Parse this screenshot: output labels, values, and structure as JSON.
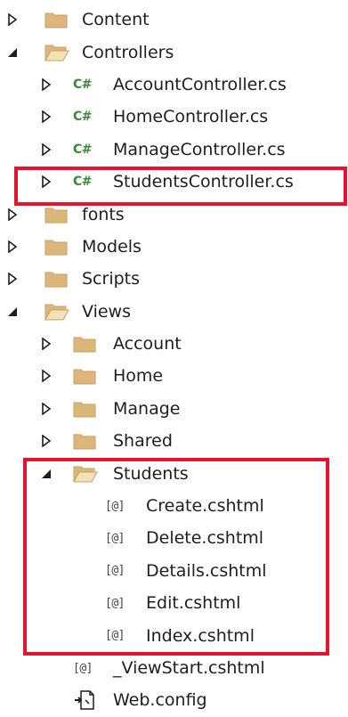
{
  "tree": {
    "content": {
      "label": "Content"
    },
    "controllers": {
      "label": "Controllers",
      "children": [
        {
          "label": "AccountController.cs"
        },
        {
          "label": "HomeController.cs"
        },
        {
          "label": "ManageController.cs"
        },
        {
          "label": "StudentsController.cs"
        }
      ]
    },
    "fonts": {
      "label": "fonts"
    },
    "models": {
      "label": "Models"
    },
    "scripts": {
      "label": "Scripts"
    },
    "views": {
      "label": "Views",
      "children": [
        {
          "label": "Account"
        },
        {
          "label": "Home"
        },
        {
          "label": "Manage"
        },
        {
          "label": "Shared"
        }
      ],
      "students": {
        "label": "Students",
        "files": [
          {
            "label": "Create.cshtml"
          },
          {
            "label": "Delete.cshtml"
          },
          {
            "label": "Details.cshtml"
          },
          {
            "label": "Edit.cshtml"
          },
          {
            "label": "Index.cshtml"
          }
        ]
      },
      "viewstart": {
        "label": "_ViewStart.cshtml"
      }
    },
    "webconfig": {
      "label": "Web.config"
    }
  },
  "icon_glyphs": {
    "cs_badge": "C#",
    "razor_badge": "[@]"
  },
  "colors": {
    "folder": "#dcb67a",
    "folder_dark": "#c9a15f",
    "highlight": "#e5132e",
    "cs_green": "#388a34",
    "text": "#1e1e1e",
    "arrow": "#1e1e1e"
  }
}
